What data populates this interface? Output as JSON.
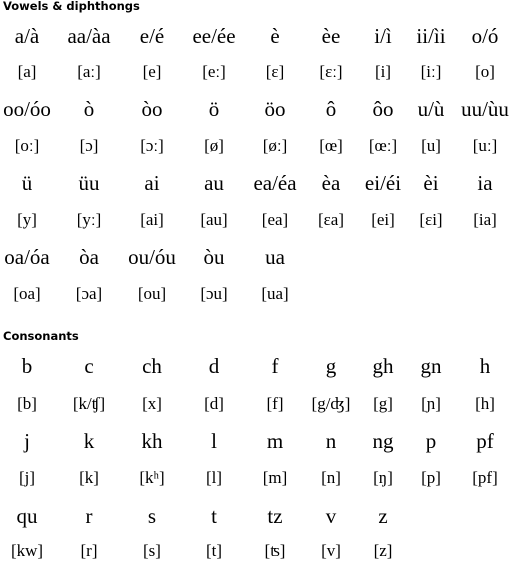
{
  "sections": [
    {
      "title": "Vowels & diphthongs",
      "rows": [
        {
          "graphemes": [
            "a/à",
            "aa/àa",
            "e/é",
            "ee/ée",
            "è",
            "èe",
            "i/ì",
            "ii/ìi",
            "o/ó"
          ],
          "ipa": [
            "[a]",
            "[aː]",
            "[e]",
            "[eː]",
            "[ɛ]",
            "[ɛː]",
            "[i]",
            "[iː]",
            "[o]"
          ]
        },
        {
          "graphemes": [
            "oo/óo",
            "ò",
            "òo",
            "ö",
            "öo",
            "ô",
            "ôo",
            "u/ù",
            "uu/ùu"
          ],
          "ipa": [
            "[oː]",
            "[ɔ]",
            "[ɔː]",
            "[ø]",
            "[øː]",
            "[œ]",
            "[œː]",
            "[u]",
            "[uː]"
          ]
        },
        {
          "graphemes": [
            "ü",
            "üu",
            "ai",
            "au",
            "ea/éa",
            "èa",
            "ei/éi",
            "èi",
            "ia"
          ],
          "ipa": [
            "[y]",
            "[yː]",
            "[ai]",
            "[au]",
            "[ea]",
            "[ɛa]",
            "[ei]",
            "[ɛi]",
            "[ia]"
          ]
        },
        {
          "graphemes": [
            "oa/óa",
            "òa",
            "ou/óu",
            "òu",
            "ua"
          ],
          "ipa": [
            "[oa]",
            "[ɔa]",
            "[ou]",
            "[ɔu]",
            "[ua]"
          ]
        }
      ]
    },
    {
      "title": "Consonants",
      "rows": [
        {
          "graphemes": [
            "b",
            "c",
            "ch",
            "d",
            "f",
            "g",
            "gh",
            "gn",
            "h"
          ],
          "ipa": [
            "[b]",
            "[k/ʧ]",
            "[x]",
            "[d]",
            "[f]",
            "[g/ʤ]",
            "[g]",
            "[ɲ]",
            "[h]"
          ]
        },
        {
          "graphemes": [
            "j",
            "k",
            "kh",
            "l",
            "m",
            "n",
            "ng",
            "p",
            "pf"
          ],
          "ipa": [
            "[j]",
            "[k]",
            "[kʰ]",
            "[l]",
            "[m]",
            "[n]",
            "[ŋ]",
            "[p]",
            "[pf]"
          ]
        },
        {
          "graphemes": [
            "qu",
            "r",
            "s",
            "t",
            "tz",
            "v",
            "z"
          ],
          "ipa": [
            "[kw]",
            "[r]",
            "[s]",
            "[t]",
            "[ʦ]",
            "[v]",
            "[z]"
          ]
        }
      ]
    }
  ]
}
